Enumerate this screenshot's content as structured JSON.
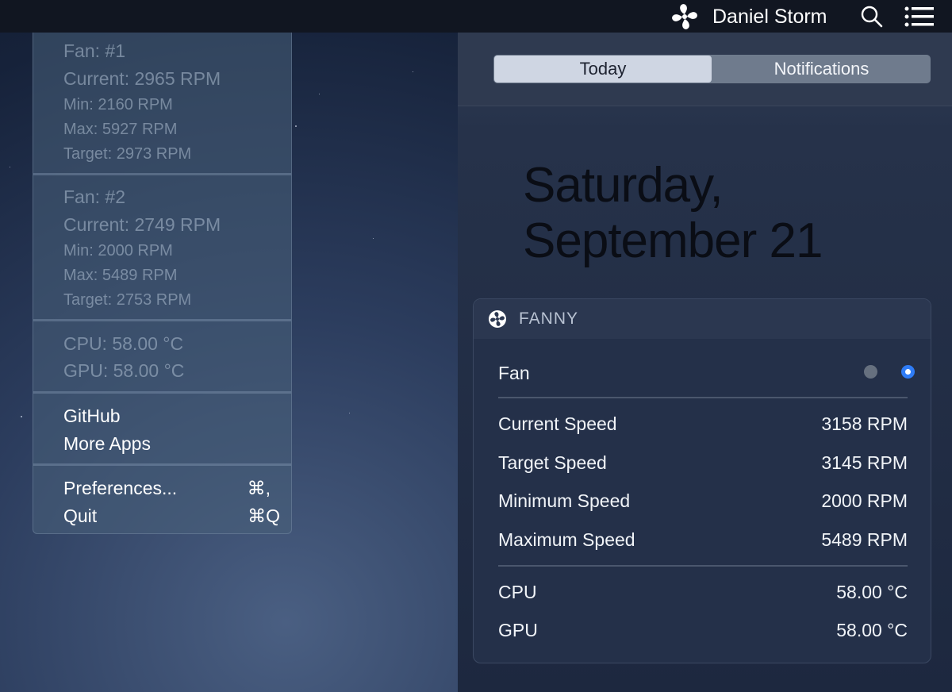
{
  "menubar": {
    "user_name": "Daniel Storm",
    "icons": [
      "fan-icon",
      "search-icon",
      "notification-center-icon"
    ]
  },
  "menu": {
    "fan1": {
      "title": "Fan: #1",
      "current": "Current: 2965 RPM",
      "min": "Min: 2160 RPM",
      "max": "Max: 5927 RPM",
      "target": "Target: 2973 RPM"
    },
    "fan2": {
      "title": "Fan: #2",
      "current": "Current: 2749 RPM",
      "min": "Min: 2000 RPM",
      "max": "Max: 5489 RPM",
      "target": "Target: 2753 RPM"
    },
    "temps": {
      "cpu": "CPU: 58.00 °C",
      "gpu": "GPU: 58.00 °C"
    },
    "links": {
      "github": "GitHub",
      "more_apps": "More Apps"
    },
    "actions": {
      "preferences": "Preferences...",
      "preferences_shortcut": "⌘,",
      "quit": "Quit",
      "quit_shortcut": "⌘Q"
    }
  },
  "notification_center": {
    "tabs": {
      "today": "Today",
      "notifications": "Notifications",
      "selected": "Today"
    },
    "date_line1": "Saturday,",
    "date_line2": "September 21",
    "widget": {
      "title": "FANNY",
      "fan_label": "Fan",
      "fan_selected_index": 2,
      "rows": [
        {
          "label": "Current Speed",
          "value": "3158 RPM"
        },
        {
          "label": "Target Speed",
          "value": "3145 RPM"
        },
        {
          "label": "Minimum Speed",
          "value": "2000 RPM"
        },
        {
          "label": "Maximum Speed",
          "value": "5489 RPM"
        }
      ],
      "temps": [
        {
          "label": "CPU",
          "value": "58.00 °C"
        },
        {
          "label": "GPU",
          "value": "58.00 °C"
        }
      ]
    }
  },
  "colors": {
    "menubar_bg": "#111621",
    "accent_radio": "#2f7cf6",
    "widget_bg": "#243049"
  }
}
